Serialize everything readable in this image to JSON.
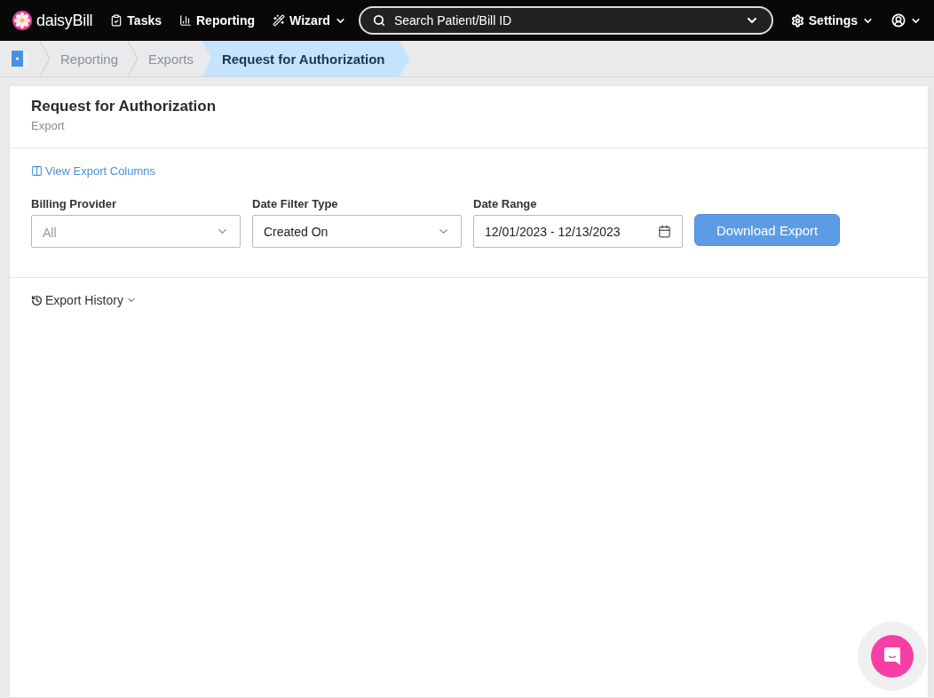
{
  "nav": {
    "brand": "daisyBill",
    "items": [
      {
        "label": "Tasks",
        "kind": "tasks",
        "dropdown": false
      },
      {
        "label": "Reporting",
        "kind": "reporting",
        "dropdown": false
      },
      {
        "label": "Wizard",
        "kind": "wizard",
        "dropdown": true
      }
    ],
    "search": {
      "placeholder": "Search Patient/Bill ID"
    },
    "settings": {
      "label": "Settings"
    }
  },
  "breadcrumbs": [
    {
      "label": "Reporting",
      "selected": false
    },
    {
      "label": "Exports",
      "selected": false
    },
    {
      "label": "Request for Authorization",
      "selected": true
    }
  ],
  "page": {
    "title": "Request for Authorization",
    "subtitle": "Export"
  },
  "columns_link": "View Export Columns",
  "filters": [
    {
      "label": "Billing Provider",
      "kind": "select",
      "placeholder": "All"
    },
    {
      "label": "Date Filter Type",
      "kind": "select",
      "value": "Created On"
    },
    {
      "label": "Date Range",
      "kind": "date",
      "value": "12/01/2023 - 12/13/2023"
    }
  ],
  "download_button": "Download Export",
  "history": {
    "label": "Export History",
    "expanded": false
  }
}
